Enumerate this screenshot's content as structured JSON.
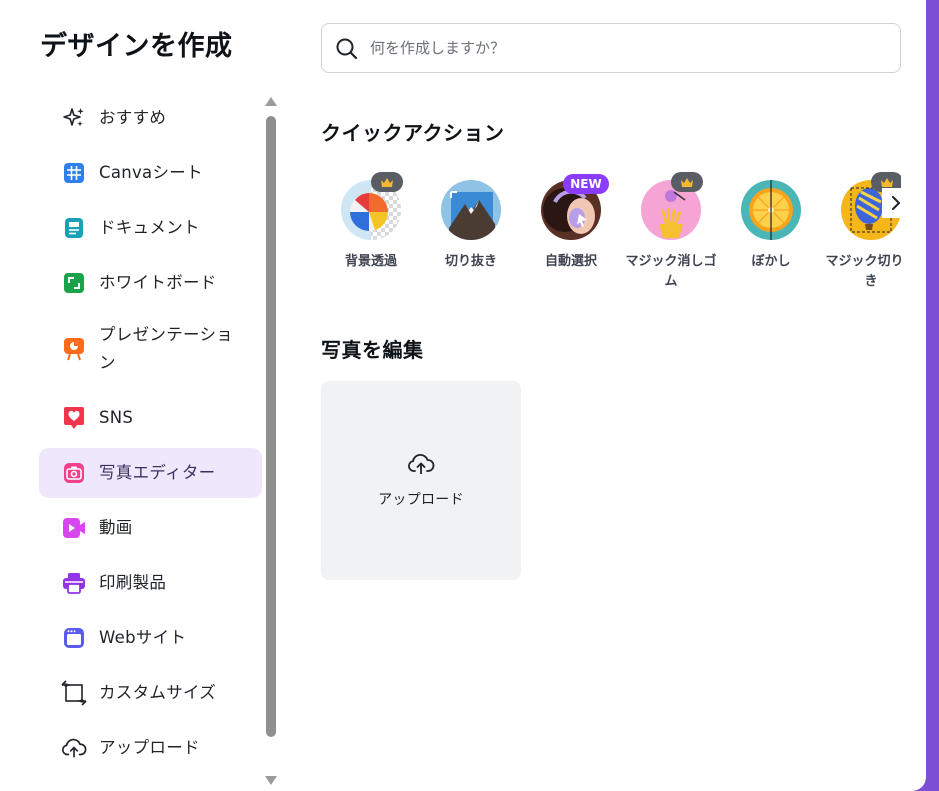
{
  "dialog": {
    "title": "デザインを作成"
  },
  "search": {
    "placeholder": "何を作成しますか？"
  },
  "sidebar": {
    "items": [
      {
        "label": "おすすめ",
        "icon": "sparkles-icon"
      },
      {
        "label": "Canvaシート",
        "icon": "sheet-icon",
        "color": "#2f80ed"
      },
      {
        "label": "ドキュメント",
        "icon": "doc-icon",
        "color": "#17a2b8"
      },
      {
        "label": "ホワイトボード",
        "icon": "whiteboard-icon",
        "color": "#1aa34a"
      },
      {
        "label": "プレゼンテーション",
        "icon": "presentation-icon",
        "color": "#ff6b1a"
      },
      {
        "label": "SNS",
        "icon": "heart-icon",
        "color": "#f0364b"
      },
      {
        "label": "写真エディター",
        "icon": "camera-icon",
        "color": "#f43f8b",
        "active": true
      },
      {
        "label": "動画",
        "icon": "video-icon",
        "color": "#d946ef"
      },
      {
        "label": "印刷製品",
        "icon": "printer-icon",
        "color": "#9333ea"
      },
      {
        "label": "Webサイト",
        "icon": "website-icon",
        "color": "#5b5bf0"
      },
      {
        "label": "カスタムサイズ",
        "icon": "resize-icon"
      },
      {
        "label": "アップロード",
        "icon": "cloud-upload-icon"
      }
    ]
  },
  "quick_actions": {
    "title": "クイックアクション",
    "items": [
      {
        "label": "背景透過",
        "badge": "crown"
      },
      {
        "label": "切り抜き"
      },
      {
        "label": "自動選択",
        "badge": "NEW"
      },
      {
        "label": "マジック消しゴム",
        "badge": "crown"
      },
      {
        "label": "ぼかし"
      },
      {
        "label": "マジック切り抜き",
        "badge": "crown"
      }
    ],
    "next_icon": "chevron-right-icon"
  },
  "edit_photo": {
    "title": "写真を編集",
    "upload_label": "アップロード"
  },
  "colors": {
    "accent": "#8b3dff",
    "active_bg": "#efe8fc",
    "backdrop": "#7d4fd6"
  }
}
